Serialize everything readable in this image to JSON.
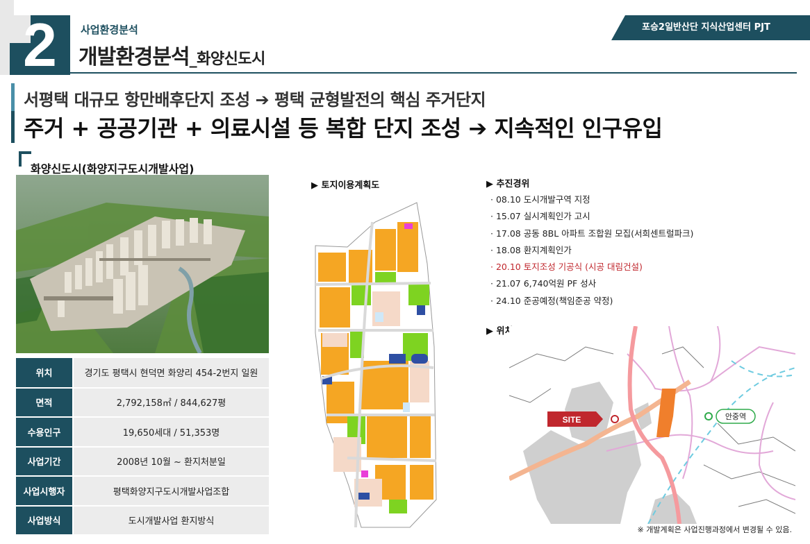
{
  "header": {
    "section_number": "2",
    "kicker": "사업환경분석",
    "title_main": "개발환경분석",
    "title_sub": "_화양신도시",
    "project_tag": "포승2일반산단 지식산업센터 PJT"
  },
  "headlines": {
    "line1": "서평택 대규모 항만배후단지 조성 ➔ 평택 균형발전의 핵심 주거단지",
    "line2": "주거 + 공공기관 + 의료시설 등 복합 단지 조성 ➔ 지속적인 인구유입"
  },
  "section_title": "화양신도시(화양지구도시개발사업)",
  "info_table": [
    {
      "label": "위치",
      "value": "경기도 평택시 현덕면 화양리 454-2번지 일원"
    },
    {
      "label": "면적",
      "value": "2,792,158㎡ / 844,627평"
    },
    {
      "label": "수용인구",
      "value": "19,650세대 / 51,353명"
    },
    {
      "label": "사업기간",
      "value": "2008년 10월 ~ 환지처분일"
    },
    {
      "label": "사업시행자",
      "value": "평택화양지구도시개발사업조합"
    },
    {
      "label": "사업방식",
      "value": "도시개발사업 환지방식"
    }
  ],
  "land_use": {
    "title": "▶ 토지이용계획도"
  },
  "progress": {
    "title": "▶ 추진경위",
    "items": [
      {
        "text": "· 08.10 도시개발구역 지정",
        "highlight": false
      },
      {
        "text": "· 15.07 실시계획인가 고시",
        "highlight": false
      },
      {
        "text": "· 17.08 공동 8BL 아파트 조합원 모집(서희센트럴파크)",
        "highlight": false
      },
      {
        "text": "· 18.08 환지계획인가",
        "highlight": false
      },
      {
        "text": "· 20.10 토지조성 기공식 (시공 대림건설)",
        "highlight": true
      },
      {
        "text": "· 21.07 6,740억원 PF 성사",
        "highlight": false
      },
      {
        "text": "· 24.10 준공예정(책임준공 약정)",
        "highlight": false
      }
    ]
  },
  "location": {
    "title": "▶ 위치도",
    "site_label": "SITE",
    "station_label": "안중역",
    "note": "※ 개발계획은 사업진행과정에서 변경될 수 있음."
  },
  "colors": {
    "primary": "#1d4f5f",
    "highlight_red": "#c0272d",
    "site_red": "#c0272d",
    "station_green": "#2eaa4a",
    "residential_orange": "#f5a623",
    "park_green": "#7ed321"
  }
}
